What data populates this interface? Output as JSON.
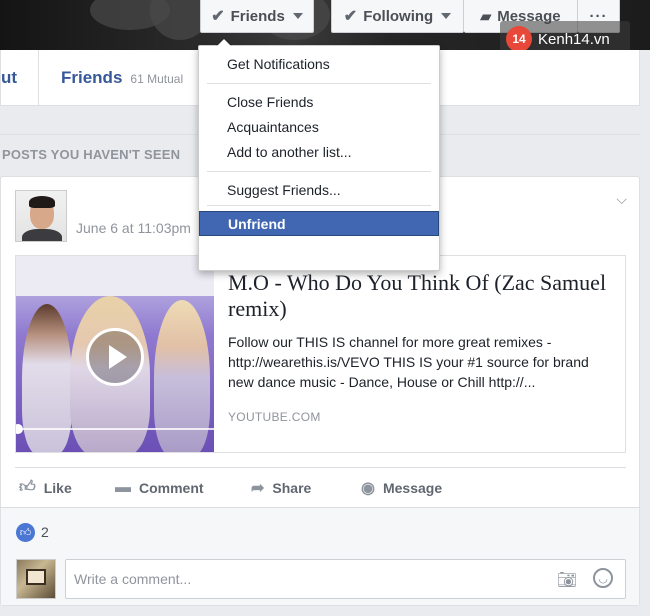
{
  "cover_actions": {
    "friends": {
      "label": "Friends"
    },
    "following": {
      "label": "Following"
    },
    "message": {
      "label": "Message"
    },
    "more": {
      "label": "···"
    }
  },
  "watermark": {
    "logo": "14",
    "text": "Kenh14.vn"
  },
  "profile_nav": {
    "about_label": "ut",
    "friends_label": "Friends",
    "mutual_count": "61 Mutual"
  },
  "section_heading": "POSTS YOU HAVEN'T SEEN",
  "post": {
    "timestamp": "June 6 at 11:03pm",
    "link": {
      "title": "M.O - Who Do You Think Of (Zac Samuel remix)",
      "description": "Follow our THIS IS channel for more great remixes - http://wearethis.is/VEVO THIS IS your #1 source for brand new dance music - Dance, House or Chill http://...",
      "source": "YOUTUBE.COM"
    },
    "actions": {
      "like": "Like",
      "comment": "Comment",
      "share": "Share",
      "message": "Message"
    },
    "like_count": "2",
    "comment_placeholder": "Write a comment..."
  },
  "dropdown": {
    "get_notifications": "Get Notifications",
    "close_friends": "Close Friends",
    "acquaintances": "Acquaintances",
    "add_to_list": "Add to another list...",
    "suggest_friends": "Suggest Friends...",
    "unfriend": "Unfriend"
  },
  "colors": {
    "facebook_blue": "#4267b2",
    "link_blue": "#365899",
    "page_bg": "#e9ebee"
  }
}
